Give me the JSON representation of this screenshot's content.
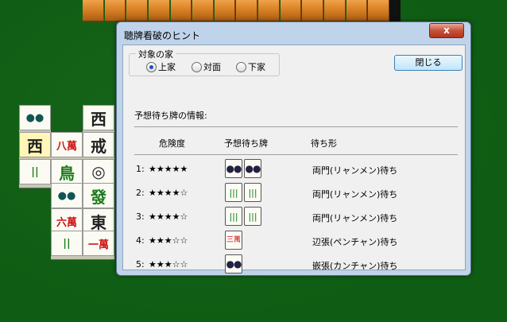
{
  "board": {
    "left_tiles": [
      {
        "face": "●●",
        "style": "blue"
      },
      {
        "face": "西",
        "style": ""
      },
      {
        "face": "西",
        "style": "hl"
      },
      {
        "face": "八萬",
        "style": "red"
      },
      {
        "face": "戒",
        "style": ""
      },
      {
        "face": "||",
        "style": "green"
      },
      {
        "face": "鳥",
        "style": "green"
      },
      {
        "face": "◎",
        "style": ""
      },
      {
        "face": "●●",
        "style": "blue"
      },
      {
        "face": "發",
        "style": "green"
      },
      {
        "face": "六萬",
        "style": "red"
      },
      {
        "face": "東",
        "style": ""
      },
      {
        "face": "||",
        "style": "green"
      },
      {
        "face": "一萬",
        "style": "red"
      }
    ]
  },
  "dialog": {
    "title": "聴牌看破のヒント",
    "close_glyph": "x",
    "group_legend": "対象の家",
    "radios": [
      {
        "label": "上家",
        "checked": true
      },
      {
        "label": "対面",
        "checked": false
      },
      {
        "label": "下家",
        "checked": false
      }
    ],
    "close_button": "閉じる",
    "info_label": "予想待ち牌の情報:",
    "headers": {
      "danger": "危険度",
      "tiles": "予想待ち牌",
      "type": "待ち形"
    },
    "rows": [
      {
        "num": "1:",
        "stars": "★★★★★",
        "tiles": [
          {
            "kind": "pin",
            "face": "●●"
          },
          {
            "kind": "pin",
            "face": "●●"
          }
        ],
        "type": "両門(リャンメン)待ち"
      },
      {
        "num": "2:",
        "stars": "★★★★☆",
        "tiles": [
          {
            "kind": "sou",
            "face": "|||"
          },
          {
            "kind": "sou",
            "face": "|||"
          }
        ],
        "type": "両門(リャンメン)待ち"
      },
      {
        "num": "3:",
        "stars": "★★★★☆",
        "tiles": [
          {
            "kind": "sou",
            "face": "|||"
          },
          {
            "kind": "sou",
            "face": "|||"
          }
        ],
        "type": "両門(リャンメン)待ち"
      },
      {
        "num": "4:",
        "stars": "★★★☆☆",
        "tiles": [
          {
            "kind": "man",
            "face": "三萬"
          }
        ],
        "type": "辺張(ペンチャン)待ち"
      },
      {
        "num": "5:",
        "stars": "★★★☆☆",
        "tiles": [
          {
            "kind": "pin",
            "face": "●●"
          }
        ],
        "type": "嵌張(カンチャン)待ち"
      }
    ]
  }
}
